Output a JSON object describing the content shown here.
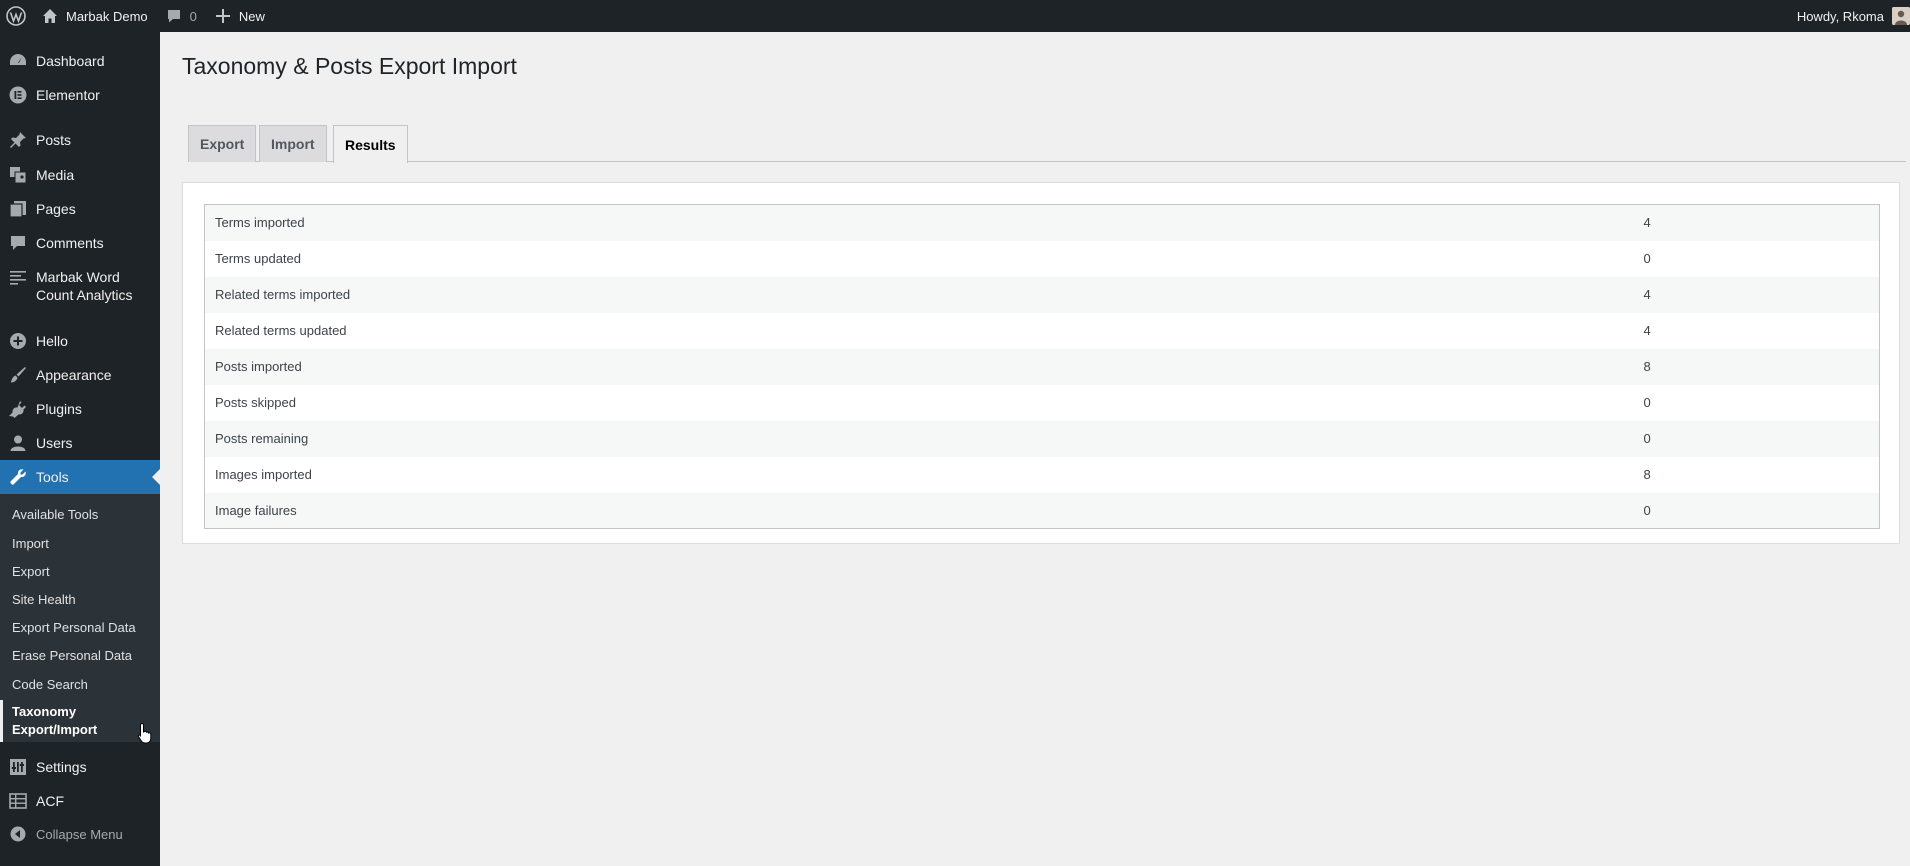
{
  "adminbar": {
    "site_name": "Marbak Demo",
    "comments_count": "0",
    "new_label": "New",
    "howdy": "Howdy, Rkoma"
  },
  "sidebar": {
    "items": [
      {
        "label": "Dashboard",
        "icon": "dashboard-icon"
      },
      {
        "label": "Elementor",
        "icon": "elementor-icon"
      },
      {
        "label": "Posts",
        "icon": "pin-icon"
      },
      {
        "label": "Media",
        "icon": "media-icon"
      },
      {
        "label": "Pages",
        "icon": "pages-icon"
      },
      {
        "label": "Comments",
        "icon": "comment-icon"
      },
      {
        "label": "Marbak Word Count Analytics",
        "line1": "Marbak Word",
        "line2": "Count Analytics",
        "icon": "list-icon"
      },
      {
        "label": "Hello",
        "icon": "plus-circle-icon"
      },
      {
        "label": "Appearance",
        "icon": "brush-icon"
      },
      {
        "label": "Plugins",
        "icon": "plugin-icon"
      },
      {
        "label": "Users",
        "icon": "user-icon"
      },
      {
        "label": "Tools",
        "icon": "wrench-icon"
      },
      {
        "label": "Settings",
        "icon": "settings-icon"
      },
      {
        "label": "ACF",
        "icon": "grid-icon"
      }
    ],
    "submenu": [
      "Available Tools",
      "Import",
      "Export",
      "Site Health",
      "Export Personal Data",
      "Erase Personal Data",
      "Code Search"
    ],
    "submenu_current": {
      "line1": "Taxonomy",
      "line2": "Export/Import"
    },
    "collapse_label": "Collapse Menu"
  },
  "page": {
    "title": "Taxonomy & Posts Export Import",
    "tabs": [
      "Export",
      "Import",
      "Results"
    ],
    "active_tab": "Results"
  },
  "results": [
    {
      "label": "Terms imported",
      "value": "4"
    },
    {
      "label": "Terms updated",
      "value": "0"
    },
    {
      "label": "Related terms imported",
      "value": "4"
    },
    {
      "label": "Related terms updated",
      "value": "4"
    },
    {
      "label": "Posts imported",
      "value": "8"
    },
    {
      "label": "Posts skipped",
      "value": "0"
    },
    {
      "label": "Posts remaining",
      "value": "0"
    },
    {
      "label": "Images imported",
      "value": "8"
    },
    {
      "label": "Image failures",
      "value": "0"
    }
  ],
  "colors": {
    "sidebar_bg": "#1d2327",
    "submenu_bg": "#2c3338",
    "accent": "#2271b1",
    "page_bg": "#f0f0f1"
  }
}
